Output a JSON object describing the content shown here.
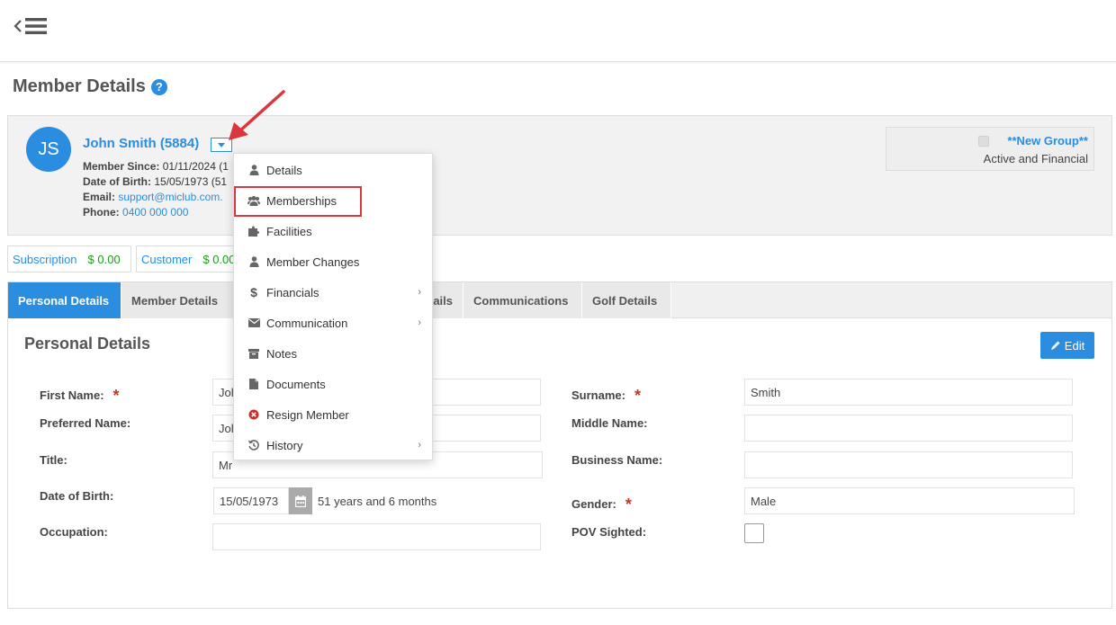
{
  "header": {
    "menu_icon": "back-hamburger-icon"
  },
  "page": {
    "title": "Member Details",
    "help_icon": "question-circle-icon",
    "help_glyph": "?"
  },
  "member": {
    "initials": "JS",
    "name": "John Smith (5884)",
    "since_label": "Member Since:",
    "since_value": "01/11/2024 (1",
    "dob_label": "Date of Birth:",
    "dob_value": "15/05/1973 (51",
    "email_label": "Email:",
    "email_value": "support@miclub.com.",
    "phone_label": "Phone:",
    "phone_value": "0400 000 000"
  },
  "group": {
    "name": "**New Group**",
    "status": "Active and Financial"
  },
  "balances": [
    {
      "label": "Subscription",
      "amount": "$ 0.00"
    },
    {
      "label": "Customer",
      "amount": "$ 0.00"
    }
  ],
  "tabs": [
    {
      "label": "Personal Details",
      "active": true
    },
    {
      "label": "Member Details"
    },
    {
      "label": "ails"
    },
    {
      "label": "Communications"
    },
    {
      "label": "Golf Details"
    }
  ],
  "section": {
    "title": "Personal Details",
    "edit_label": "Edit"
  },
  "form": {
    "first_name_label": "First Name:",
    "first_name_value": "John",
    "preferred_name_label": "Preferred Name:",
    "preferred_name_value": "John",
    "title_label": "Title:",
    "title_value": "Mr",
    "dob_label": "Date of Birth:",
    "dob_value": "15/05/1973",
    "age_text": "51 years and 6 months",
    "occupation_label": "Occupation:",
    "occupation_value": "",
    "surname_label": "Surname:",
    "surname_value": "Smith",
    "middle_name_label": "Middle Name:",
    "middle_name_value": "",
    "business_name_label": "Business Name:",
    "business_name_value": "",
    "gender_label": "Gender:",
    "gender_value": "Male",
    "pov_label": "POV Sighted:",
    "required_mark": "*"
  },
  "dropdown": {
    "items": [
      {
        "label": "Details",
        "icon": "user-icon"
      },
      {
        "label": "Memberships",
        "icon": "users-icon",
        "highlighted": true
      },
      {
        "label": "Facilities",
        "icon": "puzzle-icon"
      },
      {
        "label": "Member Changes",
        "icon": "user-icon"
      },
      {
        "label": "Financials",
        "icon": "dollar-icon",
        "submenu": true
      },
      {
        "label": "Communication",
        "icon": "envelope-icon",
        "submenu": true
      },
      {
        "label": "Notes",
        "icon": "archive-icon"
      },
      {
        "label": "Documents",
        "icon": "file-icon"
      },
      {
        "label": "Resign Member",
        "icon": "times-circle-icon"
      },
      {
        "label": "History",
        "icon": "history-icon",
        "submenu": true
      }
    ],
    "dollar_glyph": "$",
    "chevron_glyph": "›"
  },
  "colors": {
    "primary": "#2a8de0",
    "money": "#1a9d1a",
    "annotation": "#d9363e",
    "required": "#c0392b"
  }
}
